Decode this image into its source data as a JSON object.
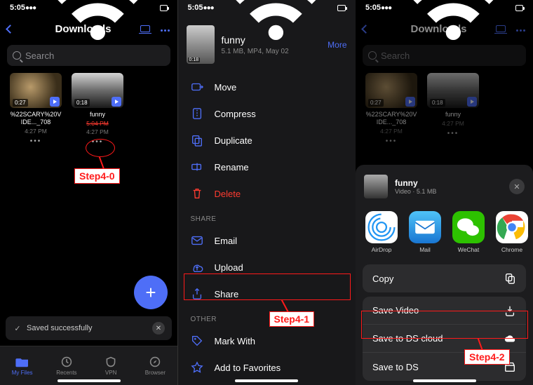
{
  "status": {
    "time": "5:05"
  },
  "phone1": {
    "title": "Downloads",
    "search_placeholder": "Search",
    "files": [
      {
        "duration": "0:27",
        "name": "%22SCARY%20VIDE..._708",
        "time": "4:27 PM"
      },
      {
        "duration": "0:18",
        "name": "funny",
        "time": "5:04 PM",
        "time2": "4:27 PM"
      }
    ],
    "toast": "Saved successfully",
    "tabs": [
      "My Files",
      "Recents",
      "VPN",
      "Browser"
    ],
    "annotation": "Step4-0"
  },
  "phone2": {
    "file": {
      "name": "funny",
      "meta": "5.1 MB, MP4, May 02",
      "duration": "0:18"
    },
    "more": "More",
    "actions_main": [
      "Move",
      "Compress",
      "Duplicate",
      "Rename",
      "Delete"
    ],
    "share_header": "SHARE",
    "actions_share": [
      "Email",
      "Upload",
      "Share"
    ],
    "other_header": "OTHER",
    "actions_other": [
      "Mark With",
      "Add to Favorites"
    ],
    "annotation": "Step4-1"
  },
  "phone3": {
    "title": "Downloads",
    "files_same_as_phone1": true,
    "sheet": {
      "name": "funny",
      "meta": "Video · 5.1 MB",
      "apps": [
        "AirDrop",
        "Mail",
        "WeChat",
        "Chrome"
      ],
      "actions": [
        "Copy",
        "Save Video",
        "Save to DS cloud",
        "Save to DS"
      ]
    },
    "annotation": "Step4-2"
  }
}
